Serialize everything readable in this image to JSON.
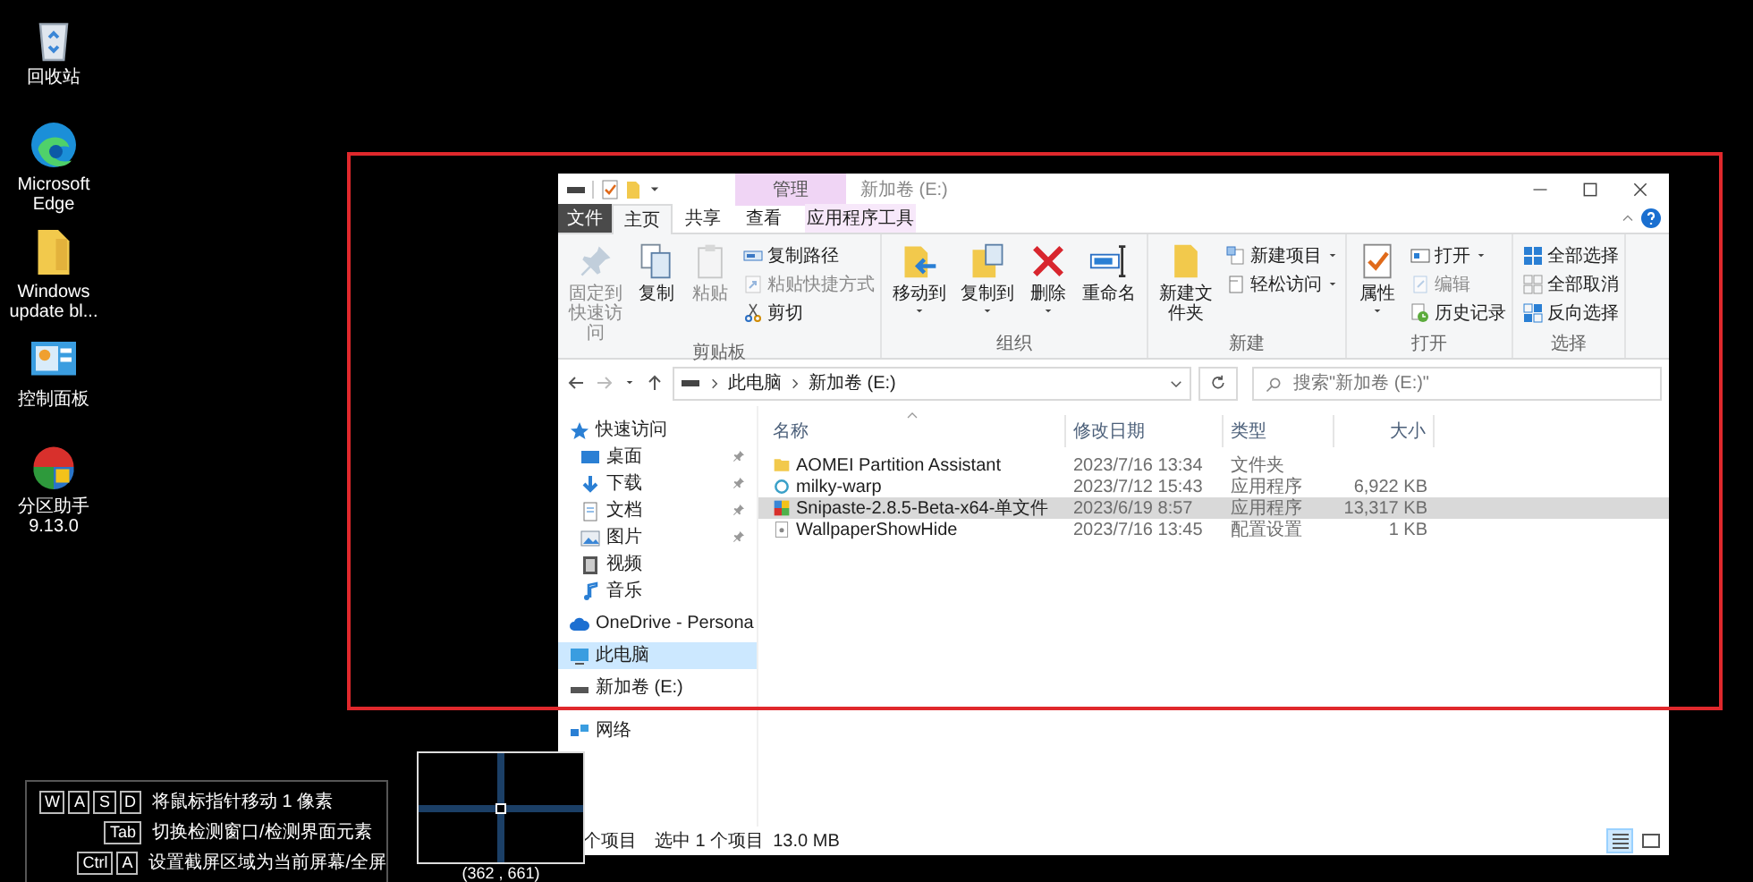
{
  "desktop_icons": [
    {
      "label": "回收站"
    },
    {
      "label": "Microsoft Edge"
    },
    {
      "label": "Windows update bl..."
    },
    {
      "label": "控制面板"
    },
    {
      "label": "分区助手 9.13.0"
    }
  ],
  "explorer": {
    "title": "新加卷 (E:)",
    "context_group": "管理",
    "tabs": [
      {
        "label": "文件",
        "kind": "file",
        "selected": false
      },
      {
        "label": "主页",
        "kind": "normal",
        "selected": true
      },
      {
        "label": "共享",
        "kind": "normal",
        "selected": false
      },
      {
        "label": "查看",
        "kind": "normal",
        "selected": false
      },
      {
        "label": "应用程序工具",
        "kind": "context",
        "selected": false
      }
    ],
    "ribbon": [
      {
        "label": "剪贴板",
        "items": [
          {
            "label": "固定到快速访问",
            "kind": "large",
            "disabled": true,
            "dropdown": false
          },
          {
            "label": "复制",
            "kind": "large",
            "disabled": false,
            "dropdown": false
          },
          {
            "label": "粘贴",
            "kind": "large",
            "disabled": true,
            "dropdown": false
          },
          {
            "label": "复制路径",
            "kind": "small",
            "disabled": false,
            "dropdown": false
          },
          {
            "label": "粘贴快捷方式",
            "kind": "small",
            "disabled": true,
            "dropdown": false
          },
          {
            "label": "剪切",
            "kind": "small",
            "disabled": false,
            "dropdown": false
          }
        ]
      },
      {
        "label": "组织",
        "items": [
          {
            "label": "移动到",
            "kind": "large",
            "disabled": false,
            "dropdown": true
          },
          {
            "label": "复制到",
            "kind": "large",
            "disabled": false,
            "dropdown": true
          },
          {
            "label": "删除",
            "kind": "large",
            "disabled": false,
            "dropdown": true
          },
          {
            "label": "重命名",
            "kind": "large",
            "disabled": false,
            "dropdown": false
          }
        ]
      },
      {
        "label": "新建",
        "items": [
          {
            "label": "新建文件夹",
            "kind": "large",
            "disabled": false,
            "dropdown": false
          },
          {
            "label": "新建项目",
            "kind": "small",
            "disabled": false,
            "dropdown": true
          },
          {
            "label": "轻松访问",
            "kind": "small",
            "disabled": false,
            "dropdown": true
          }
        ]
      },
      {
        "label": "打开",
        "items": [
          {
            "label": "属性",
            "kind": "large",
            "disabled": false,
            "dropdown": true
          },
          {
            "label": "打开",
            "kind": "small",
            "disabled": false,
            "dropdown": true
          },
          {
            "label": "编辑",
            "kind": "small",
            "disabled": true,
            "dropdown": false
          },
          {
            "label": "历史记录",
            "kind": "small",
            "disabled": false,
            "dropdown": false
          }
        ]
      },
      {
        "label": "选择",
        "items": [
          {
            "label": "全部选择",
            "kind": "small",
            "disabled": false,
            "dropdown": false
          },
          {
            "label": "全部取消",
            "kind": "small",
            "disabled": false,
            "dropdown": false
          },
          {
            "label": "反向选择",
            "kind": "small",
            "disabled": false,
            "dropdown": false
          }
        ]
      }
    ],
    "address": [
      "此电脑",
      "新加卷 (E:)"
    ],
    "search": {
      "placeholder": "搜索\"新加卷 (E:)\""
    },
    "nav": [
      {
        "label": "快速访问",
        "selected": false,
        "children": [
          {
            "label": "桌面",
            "pinned": true,
            "selected": false
          },
          {
            "label": "下载",
            "pinned": true,
            "selected": false
          },
          {
            "label": "文档",
            "pinned": true,
            "selected": false
          },
          {
            "label": "图片",
            "pinned": true,
            "selected": false
          },
          {
            "label": "视频",
            "pinned": false,
            "selected": false
          },
          {
            "label": "音乐",
            "pinned": false,
            "selected": false
          }
        ]
      },
      {
        "label": "OneDrive - Persona",
        "selected": false
      },
      {
        "label": "此电脑",
        "selected": true
      },
      {
        "label": "新加卷 (E:)",
        "selected": false
      },
      {
        "label": "网络",
        "selected": false
      }
    ],
    "columns": [
      "名称",
      "修改日期",
      "类型",
      "大小"
    ],
    "files": [
      {
        "name": "AOMEI Partition Assistant",
        "date": "2023/7/16 13:34",
        "type": "文件夹",
        "selected": false
      },
      {
        "name": "milky-warp",
        "date": "2023/7/12 15:43",
        "type": "应用程序",
        "size": "6,922 KB",
        "selected": false
      },
      {
        "name": "Snipaste-2.8.5-Beta-x64-单文件",
        "date": "2023/6/19 8:57",
        "type": "应用程序",
        "size": "13,317 KB",
        "selected": true
      },
      {
        "name": "WallpaperShowHide",
        "date": "2023/7/16 13:45",
        "type": "配置设置",
        "size": "1 KB",
        "selected": false
      }
    ],
    "status": {
      "count": "个项目",
      "selection": "选中 1 个项目",
      "size": "13.0 MB"
    },
    "view_buttons": [
      {
        "kind": "details",
        "selected": true
      },
      {
        "kind": "large_icons",
        "selected": false
      }
    ]
  },
  "shortcut_hints": [
    {
      "keys": [
        "W",
        "A",
        "S",
        "D"
      ],
      "text": "将鼠标指针移动 1 像素"
    },
    {
      "keys": [
        "Tab"
      ],
      "text": "切换检测窗口/检测界面元素"
    },
    {
      "keys": [
        "Ctrl",
        "A"
      ],
      "text": "设置截屏区域为当前屏幕/全屏"
    }
  ],
  "magnifier": {
    "coordinates": "(362 , 661)"
  }
}
